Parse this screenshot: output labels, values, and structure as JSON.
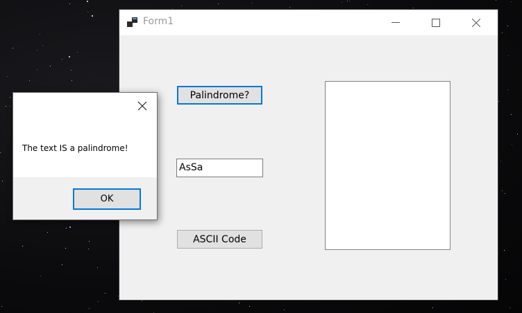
{
  "window": {
    "title": "Form1",
    "controls": {
      "minimize_icon": "minimize-icon",
      "maximize_icon": "maximize-icon",
      "close_icon": "close-icon"
    }
  },
  "form": {
    "palindrome_button": "Palindrome?",
    "text_input_value": "AsSa",
    "ascii_button": "ASCII Code",
    "listbox_items": []
  },
  "message_box": {
    "message": "The text IS a palindrome!",
    "ok_label": "OK",
    "close_icon": "close-icon"
  },
  "colors": {
    "accent": "#0078d7",
    "window_bg": "#f0f0f0",
    "button_bg": "#e1e1e1"
  }
}
